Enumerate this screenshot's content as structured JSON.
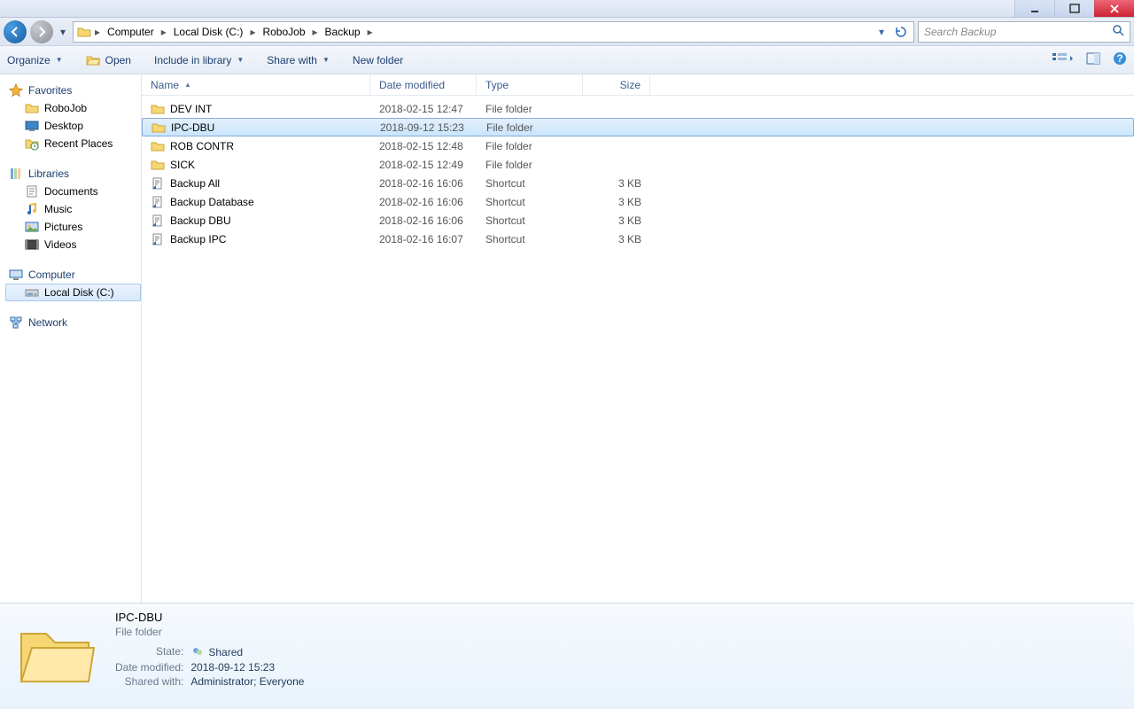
{
  "window": {
    "minimize": "min",
    "maximize": "max",
    "close": "close"
  },
  "breadcrumb": {
    "items": [
      "Computer",
      "Local Disk (C:)",
      "RoboJob",
      "Backup"
    ]
  },
  "search": {
    "placeholder": "Search Backup"
  },
  "toolbar": {
    "organize": "Organize",
    "open": "Open",
    "include": "Include in library",
    "share": "Share with",
    "newfolder": "New folder"
  },
  "sidebar": {
    "favorites": {
      "label": "Favorites",
      "items": [
        "RoboJob",
        "Desktop",
        "Recent Places"
      ]
    },
    "libraries": {
      "label": "Libraries",
      "items": [
        "Documents",
        "Music",
        "Pictures",
        "Videos"
      ]
    },
    "computer": {
      "label": "Computer",
      "items": [
        "Local Disk (C:)"
      ]
    },
    "network": {
      "label": "Network"
    }
  },
  "columns": {
    "name": "Name",
    "date": "Date modified",
    "type": "Type",
    "size": "Size"
  },
  "rows": [
    {
      "name": "DEV INT",
      "date": "2018-02-15 12:47",
      "type": "File folder",
      "size": "",
      "icon": "folder",
      "selected": false
    },
    {
      "name": "IPC-DBU",
      "date": "2018-09-12 15:23",
      "type": "File folder",
      "size": "",
      "icon": "folder",
      "selected": true
    },
    {
      "name": "ROB CONTR",
      "date": "2018-02-15 12:48",
      "type": "File folder",
      "size": "",
      "icon": "folder",
      "selected": false
    },
    {
      "name": "SICK",
      "date": "2018-02-15 12:49",
      "type": "File folder",
      "size": "",
      "icon": "folder",
      "selected": false
    },
    {
      "name": "Backup All",
      "date": "2018-02-16 16:06",
      "type": "Shortcut",
      "size": "3 KB",
      "icon": "shortcut",
      "selected": false
    },
    {
      "name": "Backup Database",
      "date": "2018-02-16 16:06",
      "type": "Shortcut",
      "size": "3 KB",
      "icon": "shortcut",
      "selected": false
    },
    {
      "name": "Backup DBU",
      "date": "2018-02-16 16:06",
      "type": "Shortcut",
      "size": "3 KB",
      "icon": "shortcut",
      "selected": false
    },
    {
      "name": "Backup IPC",
      "date": "2018-02-16 16:07",
      "type": "Shortcut",
      "size": "3 KB",
      "icon": "shortcut",
      "selected": false
    }
  ],
  "details": {
    "title": "IPC-DBU",
    "subtitle": "File folder",
    "props": {
      "state_k": "State:",
      "state_v": "Shared",
      "date_k": "Date modified:",
      "date_v": "2018-09-12 15:23",
      "shared_k": "Shared with:",
      "shared_v": "Administrator; Everyone"
    }
  }
}
